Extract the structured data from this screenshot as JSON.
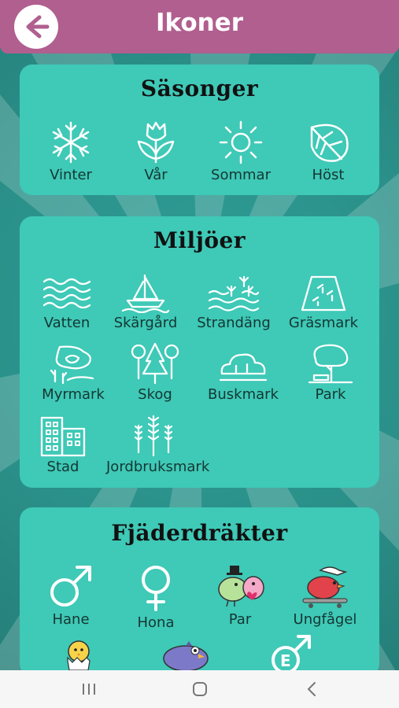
{
  "header": {
    "title": "Ikoner"
  },
  "seasons": {
    "title": "Säsonger",
    "items": [
      {
        "label": "Vinter",
        "icon": "snowflake-icon"
      },
      {
        "label": "Vår",
        "icon": "tulip-icon"
      },
      {
        "label": "Sommar",
        "icon": "sun-icon"
      },
      {
        "label": "Höst",
        "icon": "leaf-icon"
      }
    ]
  },
  "environments": {
    "title": "Miljöer",
    "items": [
      {
        "label": "Vatten",
        "icon": "water-icon"
      },
      {
        "label": "Skärgård",
        "icon": "sailboat-icon"
      },
      {
        "label": "Strandäng",
        "icon": "shore-meadow-icon"
      },
      {
        "label": "Gräsmark",
        "icon": "grassland-icon"
      },
      {
        "label": "Myrmark",
        "icon": "bog-icon"
      },
      {
        "label": "Skog",
        "icon": "forest-icon"
      },
      {
        "label": "Buskmark",
        "icon": "bush-icon"
      },
      {
        "label": "Park",
        "icon": "park-icon"
      },
      {
        "label": "Stad",
        "icon": "city-icon"
      },
      {
        "label": "Jordbruksmark",
        "icon": "farmland-icon"
      }
    ]
  },
  "plumages": {
    "title": "Fjäderdräkter",
    "items": [
      {
        "label": "Hane",
        "icon": "male-symbol-icon"
      },
      {
        "label": "Hona",
        "icon": "female-symbol-icon"
      },
      {
        "label": "Par",
        "icon": "bird-pair-icon"
      },
      {
        "label": "Ungfågel",
        "icon": "young-bird-icon"
      }
    ]
  },
  "colors": {
    "header": "#b05f8f",
    "card": "#3fc9b7",
    "background": "#2a8f88"
  },
  "navbar": {
    "icons": [
      "recent-apps-icon",
      "home-icon",
      "back-nav-icon"
    ]
  }
}
